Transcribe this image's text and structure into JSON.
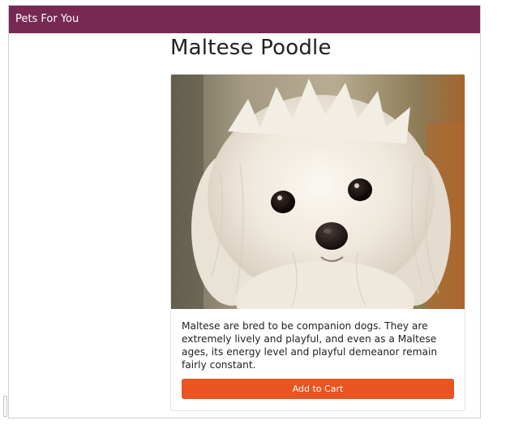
{
  "navbar": {
    "brand": "Pets For You"
  },
  "product": {
    "title": "Maltese Poodle",
    "image_subject": "white maltese poodle dog face",
    "description": "Maltese are bred to be companion dogs. They are extremely lively and playful, and even as a Maltese ages, its energy level and playful demeanor remain fairly constant.",
    "add_to_cart_label": "Add to Cart"
  },
  "colors": {
    "navbar_bg": "#772953",
    "button_bg": "#e95420",
    "text": "#222222"
  }
}
